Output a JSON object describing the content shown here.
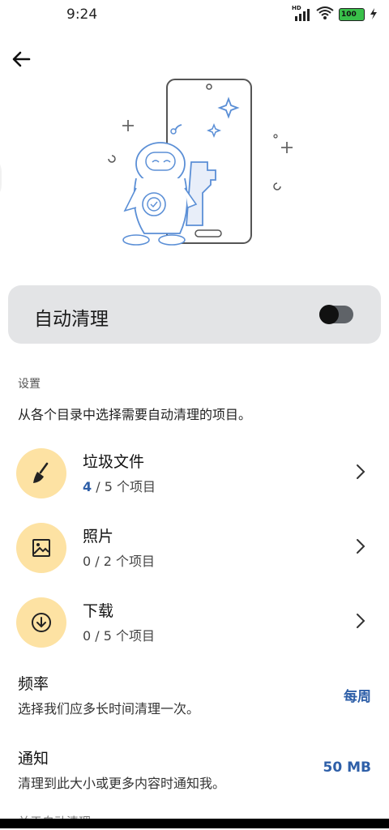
{
  "status_bar": {
    "time": "9:24",
    "network_label": "HD",
    "battery": "100"
  },
  "toggle": {
    "label": "自动清理",
    "enabled": false
  },
  "settings_section": {
    "label": "设置",
    "description": "从各个目录中选择需要自动清理的项目。"
  },
  "categories": [
    {
      "title": "垃圾文件",
      "selected": "4",
      "rest": " / 5 个项目",
      "icon": "broom-icon"
    },
    {
      "title": "照片",
      "selected": "0",
      "rest": " / 2 个项目",
      "icon": "image-icon"
    },
    {
      "title": "下载",
      "selected": "0",
      "rest": " / 5 个项目",
      "icon": "download-icon"
    }
  ],
  "frequency": {
    "title": "频率",
    "description": "选择我们应多长时间清理一次。",
    "value": "每周"
  },
  "notification": {
    "title": "通知",
    "description": "清理到此大小或更多内容时通知我。",
    "value": "50 MB"
  },
  "next_section_label": "关于自动清理",
  "colors": {
    "accent": "#2e5fa8",
    "icon_bg": "#fde2a3",
    "card_bg": "#e3e4e6"
  }
}
